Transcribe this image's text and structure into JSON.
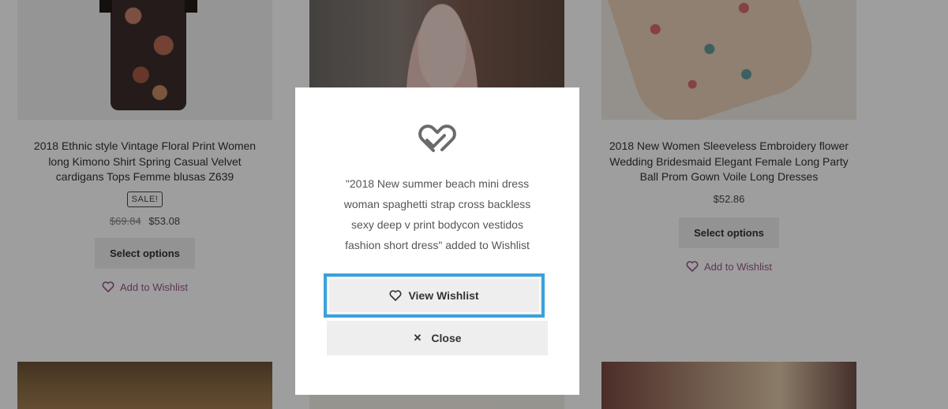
{
  "products": [
    {
      "title_lines": [
        "2018 Ethnic style Vintage Floral Print Women",
        "long Kimono Shirt Spring Casual Velvet",
        "cardigans Tops Femme blusas Z639"
      ],
      "badge": "SALE!",
      "old_price": "$69.84",
      "price": "$53.08",
      "button": "Select options",
      "wishlist": "Add to Wishlist"
    },
    {
      "title_lines": [
        "2018 New Women Sleeveless Embroidery flower",
        "Wedding Bridesmaid Elegant Female Long Party",
        "Ball Prom Gown Voile Long Dresses"
      ],
      "price": "$52.86",
      "button": "Select options",
      "wishlist": "Add to Wishlist"
    }
  ],
  "modal": {
    "icon": "heart-check-icon",
    "message_lines": [
      "\"2018 New summer beach mini dress",
      "woman spaghetti strap cross backless",
      "sexy deep v print bodycon vestidos",
      "fashion short dress\" added to Wishlist"
    ],
    "view_button": "View Wishlist",
    "close_button": "Close"
  },
  "colors": {
    "wishlist_link": "#96588a",
    "focus_border": "#3aa0dc",
    "button_bg": "#eeeeee"
  }
}
